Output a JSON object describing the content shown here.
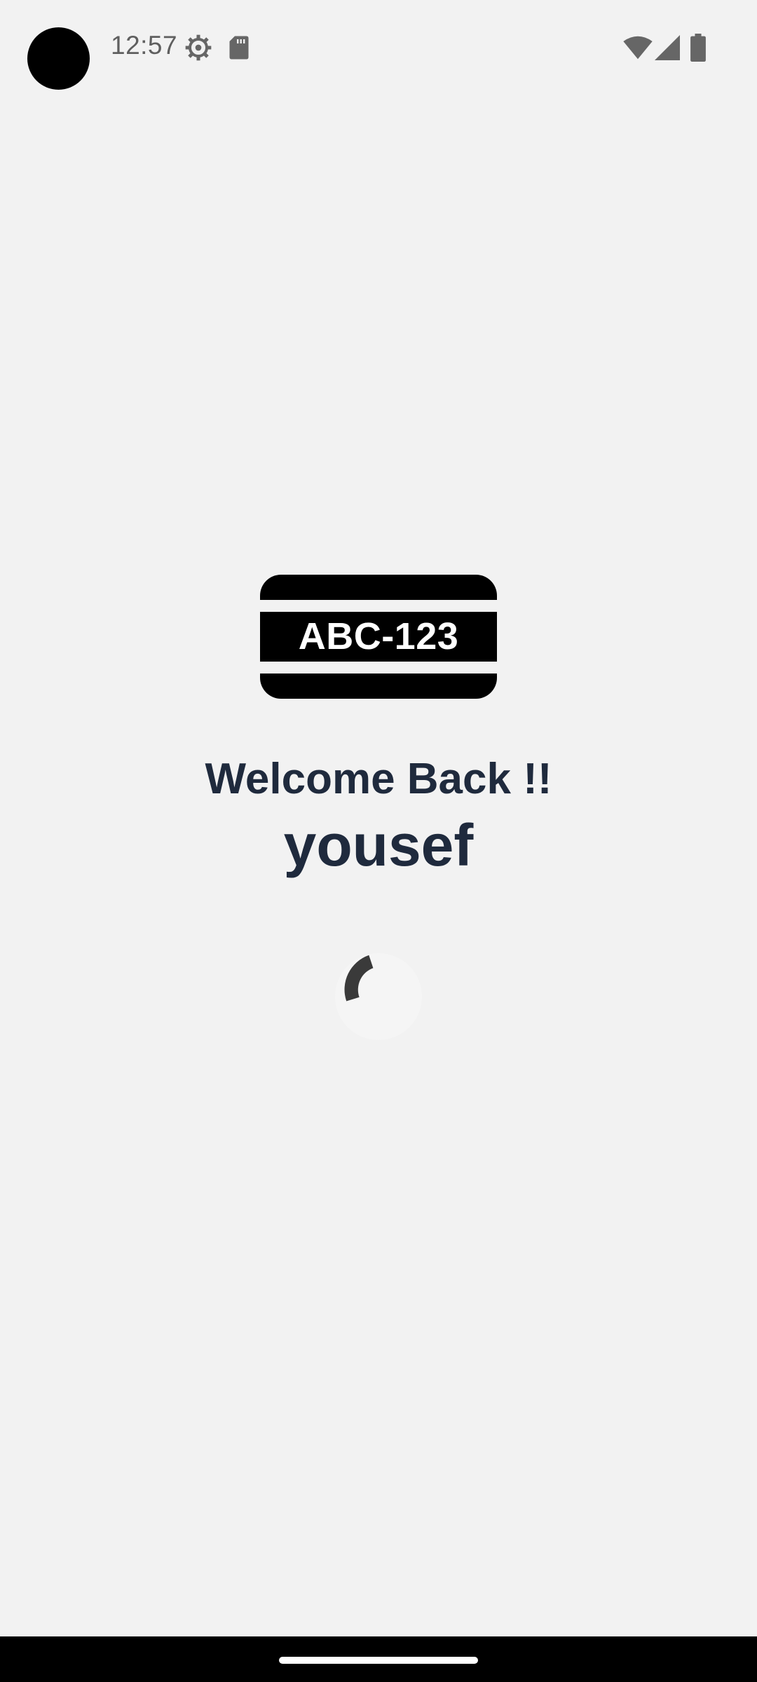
{
  "status_bar": {
    "time": "12:57",
    "icons": [
      "gear-icon",
      "sd-card-icon",
      "wifi-icon",
      "cell-signal-icon",
      "battery-icon"
    ]
  },
  "logo": {
    "text": "ABC-123"
  },
  "welcome": {
    "greeting": "Welcome Back !!",
    "username": "yousef"
  },
  "loading": {
    "indicator": "spinner-icon"
  },
  "colors": {
    "background": "#f2f2f2",
    "text_primary": "#1f2a3d",
    "logo": "#000000",
    "spinner": "#3a3a3a"
  }
}
